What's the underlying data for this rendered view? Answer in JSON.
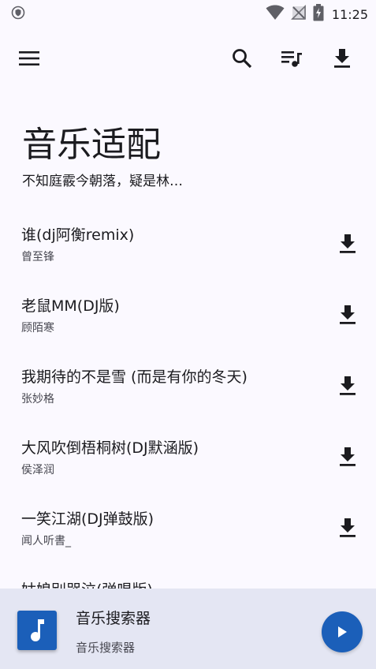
{
  "status_bar": {
    "time": "11:25",
    "icons": [
      "shield-icon",
      "wifi-icon",
      "no-signal-icon",
      "battery-charging-icon"
    ]
  },
  "app_bar": {
    "icons": [
      "menu-icon",
      "search-icon",
      "playlist-icon",
      "download-icon"
    ]
  },
  "header": {
    "title": "音乐适配",
    "subtitle": "不知庭霰今朝落，疑是林…"
  },
  "songs": [
    {
      "title": "谁(dj阿衡remix)",
      "artist": "曾至锋"
    },
    {
      "title": "老鼠MM(DJ版)",
      "artist": "顾陌寒"
    },
    {
      "title": "我期待的不是雪 (而是有你的冬天)",
      "artist": "张妙格"
    },
    {
      "title": "大风吹倒梧桐树(DJ默涵版)",
      "artist": "侯泽润"
    },
    {
      "title": "一笑江湖(DJ弹鼓版)",
      "artist": "闻人听書_"
    },
    {
      "title": "姑娘别哭泣(弹唱版)",
      "artist": ""
    }
  ],
  "player": {
    "title": "音乐搜索器",
    "subtitle": "音乐搜索器"
  },
  "colors": {
    "background": "#fbf9ff",
    "accent": "#1b5fb9",
    "player_bg": "#e4e6f3"
  }
}
